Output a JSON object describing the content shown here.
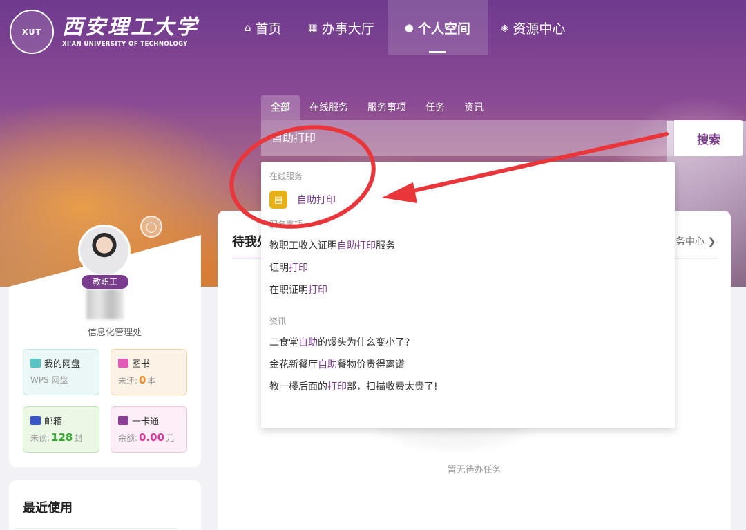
{
  "brand": {
    "seal_text": "XUT",
    "name_cn": "西安理工大学",
    "name_en": "XI'AN UNIVERSITY OF TECHNOLOGY"
  },
  "nav": [
    {
      "label": "首页",
      "icon": "home-icon"
    },
    {
      "label": "办事大厅",
      "icon": "grid-icon"
    },
    {
      "label": "个人空间",
      "icon": "user-icon",
      "active": true
    },
    {
      "label": "资源中心",
      "icon": "layers-icon"
    }
  ],
  "search": {
    "tabs": [
      "全部",
      "在线服务",
      "服务事项",
      "任务",
      "资讯"
    ],
    "active_tab": "全部",
    "query": "自助打印",
    "button_label": "搜索"
  },
  "dropdown": {
    "online_service": {
      "category": "在线服务",
      "app_label": "自助打印"
    },
    "service_items": {
      "category": "服务事项",
      "items": [
        {
          "pre": "教职工收入证明",
          "hl": "自助打印",
          "post": "服务"
        },
        {
          "pre": "证明",
          "hl": "打印",
          "post": ""
        },
        {
          "pre": "在职证明",
          "hl": "打印",
          "post": ""
        }
      ]
    },
    "news": {
      "category": "资讯",
      "items": [
        {
          "pre": "二食堂",
          "hl": "自助",
          "post": "的馒头为什么变小了?"
        },
        {
          "pre": "金花新餐厅",
          "hl": "自助",
          "post": "餐物价贵得离谱"
        },
        {
          "pre": "教一楼后面的",
          "hl": "打印",
          "post": "部，扫描收费太贵了!"
        }
      ]
    }
  },
  "profile": {
    "role": "教职工",
    "department": "信息化管理处"
  },
  "tiles": {
    "disk": {
      "title": "我的网盘",
      "sub": "WPS 网盘"
    },
    "books": {
      "title": "图书",
      "prefix": "未还:",
      "value": "0",
      "unit": "本"
    },
    "mail": {
      "title": "邮箱",
      "prefix": "未读:",
      "value": "128",
      "unit": "封"
    },
    "card": {
      "title": "一卡通",
      "prefix": "余额:",
      "value": "0.00",
      "unit": "元"
    }
  },
  "recent": {
    "title": "最近使用"
  },
  "todo": {
    "title": "待我处理",
    "link": "务中心",
    "empty": "暂无待办任务"
  },
  "colors": {
    "accent": "#7a3d8d",
    "annotation": "#e8363a"
  }
}
